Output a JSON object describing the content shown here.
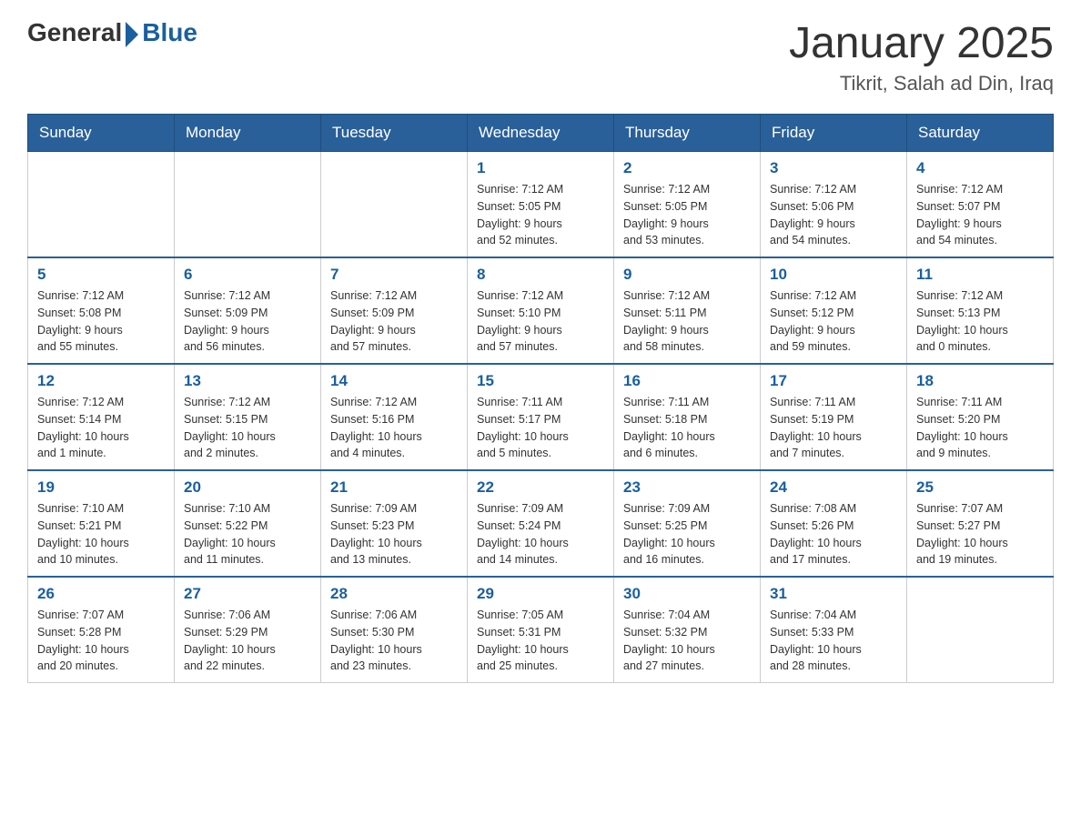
{
  "header": {
    "logo_general": "General",
    "logo_blue": "Blue",
    "main_title": "January 2025",
    "subtitle": "Tikrit, Salah ad Din, Iraq"
  },
  "calendar": {
    "days_of_week": [
      "Sunday",
      "Monday",
      "Tuesday",
      "Wednesday",
      "Thursday",
      "Friday",
      "Saturday"
    ],
    "weeks": [
      [
        {
          "day": "",
          "info": ""
        },
        {
          "day": "",
          "info": ""
        },
        {
          "day": "",
          "info": ""
        },
        {
          "day": "1",
          "info": "Sunrise: 7:12 AM\nSunset: 5:05 PM\nDaylight: 9 hours\nand 52 minutes."
        },
        {
          "day": "2",
          "info": "Sunrise: 7:12 AM\nSunset: 5:05 PM\nDaylight: 9 hours\nand 53 minutes."
        },
        {
          "day": "3",
          "info": "Sunrise: 7:12 AM\nSunset: 5:06 PM\nDaylight: 9 hours\nand 54 minutes."
        },
        {
          "day": "4",
          "info": "Sunrise: 7:12 AM\nSunset: 5:07 PM\nDaylight: 9 hours\nand 54 minutes."
        }
      ],
      [
        {
          "day": "5",
          "info": "Sunrise: 7:12 AM\nSunset: 5:08 PM\nDaylight: 9 hours\nand 55 minutes."
        },
        {
          "day": "6",
          "info": "Sunrise: 7:12 AM\nSunset: 5:09 PM\nDaylight: 9 hours\nand 56 minutes."
        },
        {
          "day": "7",
          "info": "Sunrise: 7:12 AM\nSunset: 5:09 PM\nDaylight: 9 hours\nand 57 minutes."
        },
        {
          "day": "8",
          "info": "Sunrise: 7:12 AM\nSunset: 5:10 PM\nDaylight: 9 hours\nand 57 minutes."
        },
        {
          "day": "9",
          "info": "Sunrise: 7:12 AM\nSunset: 5:11 PM\nDaylight: 9 hours\nand 58 minutes."
        },
        {
          "day": "10",
          "info": "Sunrise: 7:12 AM\nSunset: 5:12 PM\nDaylight: 9 hours\nand 59 minutes."
        },
        {
          "day": "11",
          "info": "Sunrise: 7:12 AM\nSunset: 5:13 PM\nDaylight: 10 hours\nand 0 minutes."
        }
      ],
      [
        {
          "day": "12",
          "info": "Sunrise: 7:12 AM\nSunset: 5:14 PM\nDaylight: 10 hours\nand 1 minute."
        },
        {
          "day": "13",
          "info": "Sunrise: 7:12 AM\nSunset: 5:15 PM\nDaylight: 10 hours\nand 2 minutes."
        },
        {
          "day": "14",
          "info": "Sunrise: 7:12 AM\nSunset: 5:16 PM\nDaylight: 10 hours\nand 4 minutes."
        },
        {
          "day": "15",
          "info": "Sunrise: 7:11 AM\nSunset: 5:17 PM\nDaylight: 10 hours\nand 5 minutes."
        },
        {
          "day": "16",
          "info": "Sunrise: 7:11 AM\nSunset: 5:18 PM\nDaylight: 10 hours\nand 6 minutes."
        },
        {
          "day": "17",
          "info": "Sunrise: 7:11 AM\nSunset: 5:19 PM\nDaylight: 10 hours\nand 7 minutes."
        },
        {
          "day": "18",
          "info": "Sunrise: 7:11 AM\nSunset: 5:20 PM\nDaylight: 10 hours\nand 9 minutes."
        }
      ],
      [
        {
          "day": "19",
          "info": "Sunrise: 7:10 AM\nSunset: 5:21 PM\nDaylight: 10 hours\nand 10 minutes."
        },
        {
          "day": "20",
          "info": "Sunrise: 7:10 AM\nSunset: 5:22 PM\nDaylight: 10 hours\nand 11 minutes."
        },
        {
          "day": "21",
          "info": "Sunrise: 7:09 AM\nSunset: 5:23 PM\nDaylight: 10 hours\nand 13 minutes."
        },
        {
          "day": "22",
          "info": "Sunrise: 7:09 AM\nSunset: 5:24 PM\nDaylight: 10 hours\nand 14 minutes."
        },
        {
          "day": "23",
          "info": "Sunrise: 7:09 AM\nSunset: 5:25 PM\nDaylight: 10 hours\nand 16 minutes."
        },
        {
          "day": "24",
          "info": "Sunrise: 7:08 AM\nSunset: 5:26 PM\nDaylight: 10 hours\nand 17 minutes."
        },
        {
          "day": "25",
          "info": "Sunrise: 7:07 AM\nSunset: 5:27 PM\nDaylight: 10 hours\nand 19 minutes."
        }
      ],
      [
        {
          "day": "26",
          "info": "Sunrise: 7:07 AM\nSunset: 5:28 PM\nDaylight: 10 hours\nand 20 minutes."
        },
        {
          "day": "27",
          "info": "Sunrise: 7:06 AM\nSunset: 5:29 PM\nDaylight: 10 hours\nand 22 minutes."
        },
        {
          "day": "28",
          "info": "Sunrise: 7:06 AM\nSunset: 5:30 PM\nDaylight: 10 hours\nand 23 minutes."
        },
        {
          "day": "29",
          "info": "Sunrise: 7:05 AM\nSunset: 5:31 PM\nDaylight: 10 hours\nand 25 minutes."
        },
        {
          "day": "30",
          "info": "Sunrise: 7:04 AM\nSunset: 5:32 PM\nDaylight: 10 hours\nand 27 minutes."
        },
        {
          "day": "31",
          "info": "Sunrise: 7:04 AM\nSunset: 5:33 PM\nDaylight: 10 hours\nand 28 minutes."
        },
        {
          "day": "",
          "info": ""
        }
      ]
    ]
  }
}
